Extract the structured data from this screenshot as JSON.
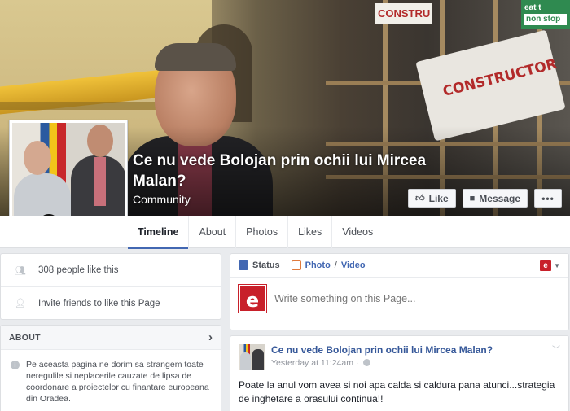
{
  "page": {
    "title": "Ce nu vede Bolojan prin ochii lui Mircea Malan?",
    "category": "Community"
  },
  "cover": {
    "sign_top": "CONSTRU",
    "banner_text": "CONSTRUCTOR",
    "eat_sign": "eat t",
    "eat_sign_small": "non stop"
  },
  "actions": {
    "like_label": "Like",
    "like_icon": "thumbs-up-icon",
    "message_label": "Message",
    "message_icon": "message-icon",
    "more_label": "•••"
  },
  "nav": {
    "tabs": [
      {
        "label": "Timeline",
        "active": true
      },
      {
        "label": "About"
      },
      {
        "label": "Photos"
      },
      {
        "label": "Likes"
      },
      {
        "label": "Videos"
      }
    ]
  },
  "sidebar": {
    "likes_count": "308 people like this",
    "invite": "Invite friends to like this Page",
    "about_heading": "ABOUT",
    "about_text": "Pe aceasta pagina ne dorim sa strangem toate neregulile si neplacerile cauzate de lipsa de coordonare a proiectelor cu finantare europeana din Oradea."
  },
  "composer": {
    "status_label": "Status",
    "photo_label": "Photo",
    "video_label": "Video",
    "logo_letter": "e",
    "placeholder": "Write something on this Page..."
  },
  "post": {
    "author": "Ce nu vede Bolojan prin ochii lui Mircea Malan?",
    "time": "Yesterday at 11:24am",
    "text": "Poate la anul vom avea si noi apa calda si caldura pana atunci...strategia de inghetare a orasului continua!!"
  },
  "colors": {
    "accent": "#4267b2",
    "brand_red": "#c8202a",
    "link": "#365899"
  }
}
